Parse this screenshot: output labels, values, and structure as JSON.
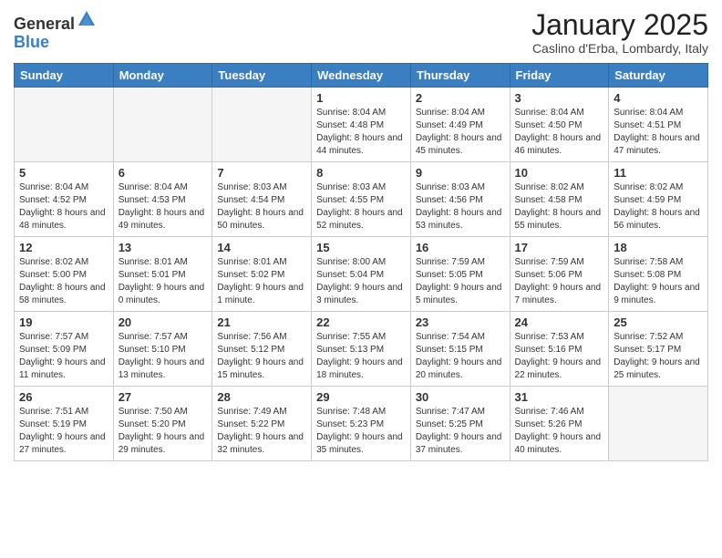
{
  "header": {
    "logo_general": "General",
    "logo_blue": "Blue",
    "month_title": "January 2025",
    "subtitle": "Caslino d'Erba, Lombardy, Italy"
  },
  "weekdays": [
    "Sunday",
    "Monday",
    "Tuesday",
    "Wednesday",
    "Thursday",
    "Friday",
    "Saturday"
  ],
  "weeks": [
    [
      {
        "day": "",
        "info": ""
      },
      {
        "day": "",
        "info": ""
      },
      {
        "day": "",
        "info": ""
      },
      {
        "day": "1",
        "info": "Sunrise: 8:04 AM\nSunset: 4:48 PM\nDaylight: 8 hours\nand 44 minutes."
      },
      {
        "day": "2",
        "info": "Sunrise: 8:04 AM\nSunset: 4:49 PM\nDaylight: 8 hours\nand 45 minutes."
      },
      {
        "day": "3",
        "info": "Sunrise: 8:04 AM\nSunset: 4:50 PM\nDaylight: 8 hours\nand 46 minutes."
      },
      {
        "day": "4",
        "info": "Sunrise: 8:04 AM\nSunset: 4:51 PM\nDaylight: 8 hours\nand 47 minutes."
      }
    ],
    [
      {
        "day": "5",
        "info": "Sunrise: 8:04 AM\nSunset: 4:52 PM\nDaylight: 8 hours\nand 48 minutes."
      },
      {
        "day": "6",
        "info": "Sunrise: 8:04 AM\nSunset: 4:53 PM\nDaylight: 8 hours\nand 49 minutes."
      },
      {
        "day": "7",
        "info": "Sunrise: 8:03 AM\nSunset: 4:54 PM\nDaylight: 8 hours\nand 50 minutes."
      },
      {
        "day": "8",
        "info": "Sunrise: 8:03 AM\nSunset: 4:55 PM\nDaylight: 8 hours\nand 52 minutes."
      },
      {
        "day": "9",
        "info": "Sunrise: 8:03 AM\nSunset: 4:56 PM\nDaylight: 8 hours\nand 53 minutes."
      },
      {
        "day": "10",
        "info": "Sunrise: 8:02 AM\nSunset: 4:58 PM\nDaylight: 8 hours\nand 55 minutes."
      },
      {
        "day": "11",
        "info": "Sunrise: 8:02 AM\nSunset: 4:59 PM\nDaylight: 8 hours\nand 56 minutes."
      }
    ],
    [
      {
        "day": "12",
        "info": "Sunrise: 8:02 AM\nSunset: 5:00 PM\nDaylight: 8 hours\nand 58 minutes."
      },
      {
        "day": "13",
        "info": "Sunrise: 8:01 AM\nSunset: 5:01 PM\nDaylight: 9 hours\nand 0 minutes."
      },
      {
        "day": "14",
        "info": "Sunrise: 8:01 AM\nSunset: 5:02 PM\nDaylight: 9 hours\nand 1 minute."
      },
      {
        "day": "15",
        "info": "Sunrise: 8:00 AM\nSunset: 5:04 PM\nDaylight: 9 hours\nand 3 minutes."
      },
      {
        "day": "16",
        "info": "Sunrise: 7:59 AM\nSunset: 5:05 PM\nDaylight: 9 hours\nand 5 minutes."
      },
      {
        "day": "17",
        "info": "Sunrise: 7:59 AM\nSunset: 5:06 PM\nDaylight: 9 hours\nand 7 minutes."
      },
      {
        "day": "18",
        "info": "Sunrise: 7:58 AM\nSunset: 5:08 PM\nDaylight: 9 hours\nand 9 minutes."
      }
    ],
    [
      {
        "day": "19",
        "info": "Sunrise: 7:57 AM\nSunset: 5:09 PM\nDaylight: 9 hours\nand 11 minutes."
      },
      {
        "day": "20",
        "info": "Sunrise: 7:57 AM\nSunset: 5:10 PM\nDaylight: 9 hours\nand 13 minutes."
      },
      {
        "day": "21",
        "info": "Sunrise: 7:56 AM\nSunset: 5:12 PM\nDaylight: 9 hours\nand 15 minutes."
      },
      {
        "day": "22",
        "info": "Sunrise: 7:55 AM\nSunset: 5:13 PM\nDaylight: 9 hours\nand 18 minutes."
      },
      {
        "day": "23",
        "info": "Sunrise: 7:54 AM\nSunset: 5:15 PM\nDaylight: 9 hours\nand 20 minutes."
      },
      {
        "day": "24",
        "info": "Sunrise: 7:53 AM\nSunset: 5:16 PM\nDaylight: 9 hours\nand 22 minutes."
      },
      {
        "day": "25",
        "info": "Sunrise: 7:52 AM\nSunset: 5:17 PM\nDaylight: 9 hours\nand 25 minutes."
      }
    ],
    [
      {
        "day": "26",
        "info": "Sunrise: 7:51 AM\nSunset: 5:19 PM\nDaylight: 9 hours\nand 27 minutes."
      },
      {
        "day": "27",
        "info": "Sunrise: 7:50 AM\nSunset: 5:20 PM\nDaylight: 9 hours\nand 29 minutes."
      },
      {
        "day": "28",
        "info": "Sunrise: 7:49 AM\nSunset: 5:22 PM\nDaylight: 9 hours\nand 32 minutes."
      },
      {
        "day": "29",
        "info": "Sunrise: 7:48 AM\nSunset: 5:23 PM\nDaylight: 9 hours\nand 35 minutes."
      },
      {
        "day": "30",
        "info": "Sunrise: 7:47 AM\nSunset: 5:25 PM\nDaylight: 9 hours\nand 37 minutes."
      },
      {
        "day": "31",
        "info": "Sunrise: 7:46 AM\nSunset: 5:26 PM\nDaylight: 9 hours\nand 40 minutes."
      },
      {
        "day": "",
        "info": ""
      }
    ]
  ]
}
